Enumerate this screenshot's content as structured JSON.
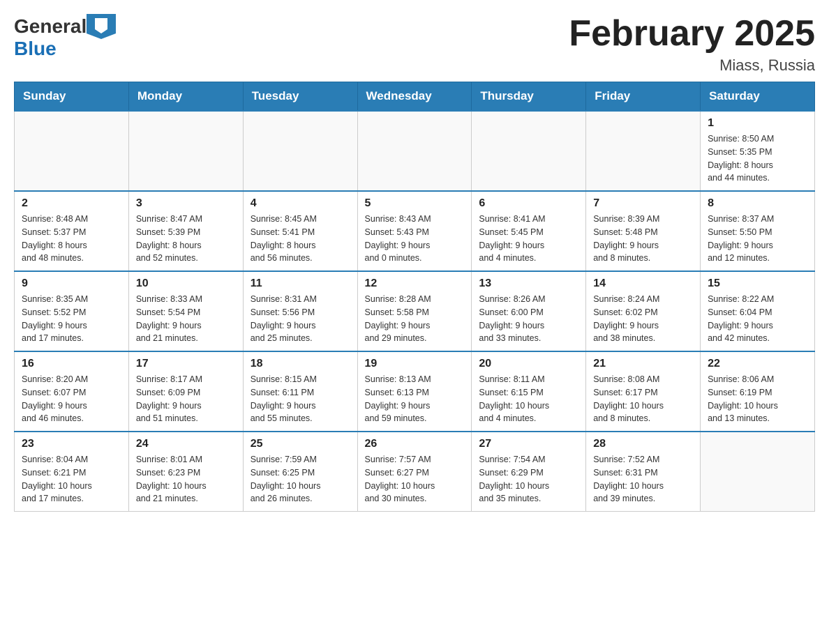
{
  "header": {
    "logo_general": "General",
    "logo_blue": "Blue",
    "title": "February 2025",
    "location": "Miass, Russia"
  },
  "days_of_week": [
    "Sunday",
    "Monday",
    "Tuesday",
    "Wednesday",
    "Thursday",
    "Friday",
    "Saturday"
  ],
  "weeks": [
    [
      {
        "day": "",
        "info": ""
      },
      {
        "day": "",
        "info": ""
      },
      {
        "day": "",
        "info": ""
      },
      {
        "day": "",
        "info": ""
      },
      {
        "day": "",
        "info": ""
      },
      {
        "day": "",
        "info": ""
      },
      {
        "day": "1",
        "info": "Sunrise: 8:50 AM\nSunset: 5:35 PM\nDaylight: 8 hours\nand 44 minutes."
      }
    ],
    [
      {
        "day": "2",
        "info": "Sunrise: 8:48 AM\nSunset: 5:37 PM\nDaylight: 8 hours\nand 48 minutes."
      },
      {
        "day": "3",
        "info": "Sunrise: 8:47 AM\nSunset: 5:39 PM\nDaylight: 8 hours\nand 52 minutes."
      },
      {
        "day": "4",
        "info": "Sunrise: 8:45 AM\nSunset: 5:41 PM\nDaylight: 8 hours\nand 56 minutes."
      },
      {
        "day": "5",
        "info": "Sunrise: 8:43 AM\nSunset: 5:43 PM\nDaylight: 9 hours\nand 0 minutes."
      },
      {
        "day": "6",
        "info": "Sunrise: 8:41 AM\nSunset: 5:45 PM\nDaylight: 9 hours\nand 4 minutes."
      },
      {
        "day": "7",
        "info": "Sunrise: 8:39 AM\nSunset: 5:48 PM\nDaylight: 9 hours\nand 8 minutes."
      },
      {
        "day": "8",
        "info": "Sunrise: 8:37 AM\nSunset: 5:50 PM\nDaylight: 9 hours\nand 12 minutes."
      }
    ],
    [
      {
        "day": "9",
        "info": "Sunrise: 8:35 AM\nSunset: 5:52 PM\nDaylight: 9 hours\nand 17 minutes."
      },
      {
        "day": "10",
        "info": "Sunrise: 8:33 AM\nSunset: 5:54 PM\nDaylight: 9 hours\nand 21 minutes."
      },
      {
        "day": "11",
        "info": "Sunrise: 8:31 AM\nSunset: 5:56 PM\nDaylight: 9 hours\nand 25 minutes."
      },
      {
        "day": "12",
        "info": "Sunrise: 8:28 AM\nSunset: 5:58 PM\nDaylight: 9 hours\nand 29 minutes."
      },
      {
        "day": "13",
        "info": "Sunrise: 8:26 AM\nSunset: 6:00 PM\nDaylight: 9 hours\nand 33 minutes."
      },
      {
        "day": "14",
        "info": "Sunrise: 8:24 AM\nSunset: 6:02 PM\nDaylight: 9 hours\nand 38 minutes."
      },
      {
        "day": "15",
        "info": "Sunrise: 8:22 AM\nSunset: 6:04 PM\nDaylight: 9 hours\nand 42 minutes."
      }
    ],
    [
      {
        "day": "16",
        "info": "Sunrise: 8:20 AM\nSunset: 6:07 PM\nDaylight: 9 hours\nand 46 minutes."
      },
      {
        "day": "17",
        "info": "Sunrise: 8:17 AM\nSunset: 6:09 PM\nDaylight: 9 hours\nand 51 minutes."
      },
      {
        "day": "18",
        "info": "Sunrise: 8:15 AM\nSunset: 6:11 PM\nDaylight: 9 hours\nand 55 minutes."
      },
      {
        "day": "19",
        "info": "Sunrise: 8:13 AM\nSunset: 6:13 PM\nDaylight: 9 hours\nand 59 minutes."
      },
      {
        "day": "20",
        "info": "Sunrise: 8:11 AM\nSunset: 6:15 PM\nDaylight: 10 hours\nand 4 minutes."
      },
      {
        "day": "21",
        "info": "Sunrise: 8:08 AM\nSunset: 6:17 PM\nDaylight: 10 hours\nand 8 minutes."
      },
      {
        "day": "22",
        "info": "Sunrise: 8:06 AM\nSunset: 6:19 PM\nDaylight: 10 hours\nand 13 minutes."
      }
    ],
    [
      {
        "day": "23",
        "info": "Sunrise: 8:04 AM\nSunset: 6:21 PM\nDaylight: 10 hours\nand 17 minutes."
      },
      {
        "day": "24",
        "info": "Sunrise: 8:01 AM\nSunset: 6:23 PM\nDaylight: 10 hours\nand 21 minutes."
      },
      {
        "day": "25",
        "info": "Sunrise: 7:59 AM\nSunset: 6:25 PM\nDaylight: 10 hours\nand 26 minutes."
      },
      {
        "day": "26",
        "info": "Sunrise: 7:57 AM\nSunset: 6:27 PM\nDaylight: 10 hours\nand 30 minutes."
      },
      {
        "day": "27",
        "info": "Sunrise: 7:54 AM\nSunset: 6:29 PM\nDaylight: 10 hours\nand 35 minutes."
      },
      {
        "day": "28",
        "info": "Sunrise: 7:52 AM\nSunset: 6:31 PM\nDaylight: 10 hours\nand 39 minutes."
      },
      {
        "day": "",
        "info": ""
      }
    ]
  ]
}
